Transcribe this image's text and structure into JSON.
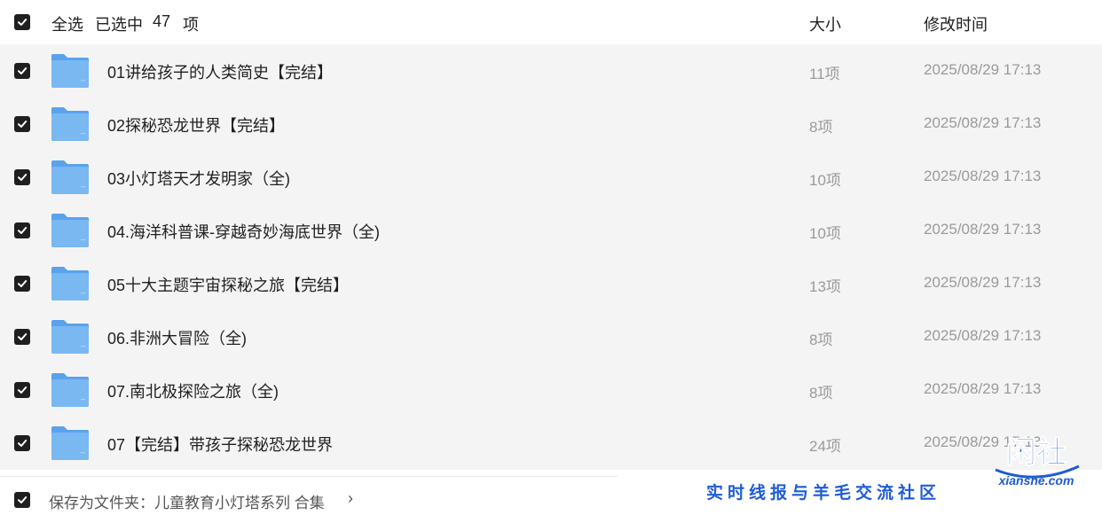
{
  "header": {
    "select_all": "全选",
    "selected_label": "已选中",
    "selected_count": "47",
    "selected_unit": "项",
    "col_size": "大小",
    "col_time": "修改时间"
  },
  "rows": [
    {
      "name": "01讲给孩子的人类简史【完结】",
      "size": "11项",
      "time": "2025/08/29 17:13"
    },
    {
      "name": "02探秘恐龙世界【完结】",
      "size": "8项",
      "time": "2025/08/29 17:13"
    },
    {
      "name": "03小灯塔天才发明家（全)",
      "size": "10项",
      "time": "2025/08/29 17:13"
    },
    {
      "name": "04.海洋科普课-穿越奇妙海底世界（全)",
      "size": "10项",
      "time": "2025/08/29 17:13"
    },
    {
      "name": "05十大主题宇宙探秘之旅【完结】",
      "size": "13项",
      "time": "2025/08/29 17:13"
    },
    {
      "name": "06.非洲大冒险（全)",
      "size": "8项",
      "time": "2025/08/29 17:13"
    },
    {
      "name": "07.南北极探险之旅（全)",
      "size": "8项",
      "time": "2025/08/29 17:13"
    },
    {
      "name": "07【完结】带孩子探秘恐龙世界",
      "size": "24项",
      "time": "2025/08/29 17:13"
    }
  ],
  "footer": {
    "save_label": "保存为文件夹：儿童教育小灯塔系列 合集",
    "chevron": "›"
  },
  "watermark": {
    "logo_text": "闲社",
    "logo_url": "xianshe.com",
    "tagline": "实时线报与羊毛交流社区",
    "color": "#1e5bd6"
  },
  "colors": {
    "checkbox": "#1f1f1f",
    "folder": "#6aaef0",
    "list_bg": "#f4f4f4"
  }
}
